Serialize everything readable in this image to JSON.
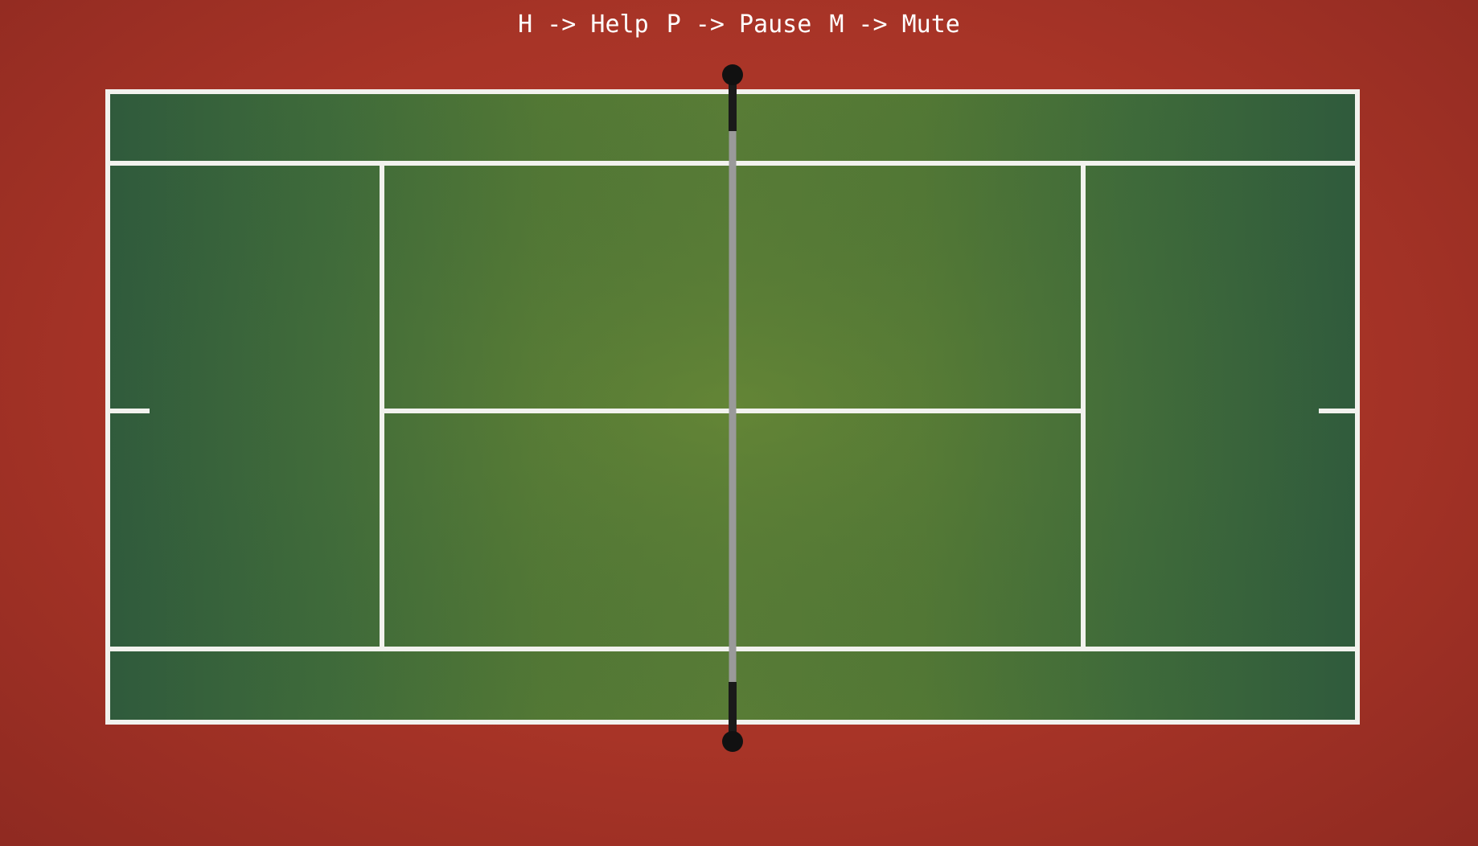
{
  "hud": {
    "help_key": "H -> Help",
    "pause_key": "P -> Pause",
    "mute_key": "M -> Mute"
  },
  "colors": {
    "surround": "#a83427",
    "court_light": "#5b7f38",
    "court_dark": "#2f5a3c",
    "lines": "#f2f2ee",
    "net": "#9a9a9a",
    "net_post": "#111111"
  }
}
